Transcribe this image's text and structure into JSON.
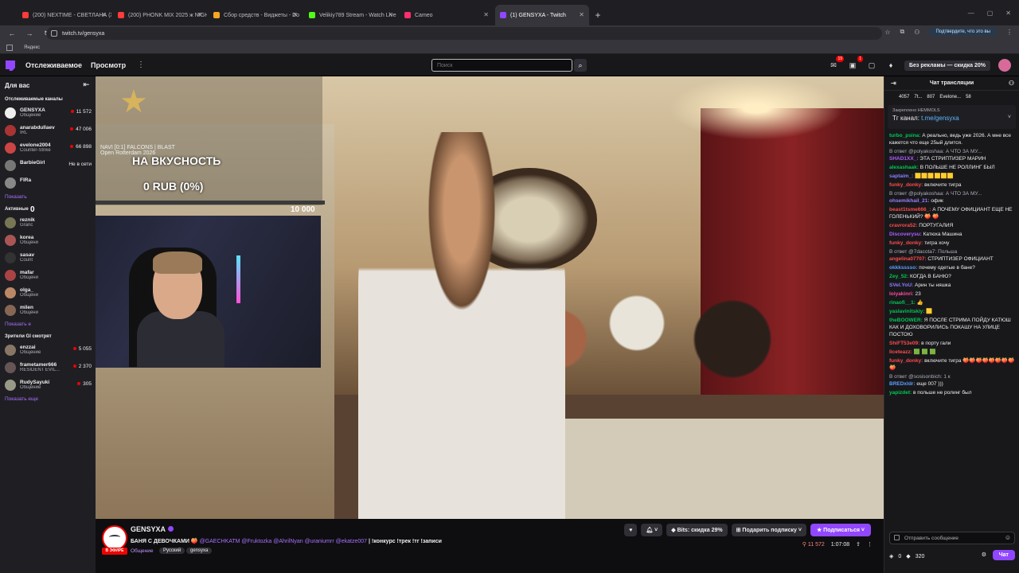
{
  "browser": {
    "tabs": [
      {
        "label": "(200) NEXTIME - СВЕТЛАНА (Ж",
        "color": "#ff3b3b"
      },
      {
        "label": "(200) PHONK MIX 2025 ж NIGH",
        "color": "#ff3b3b"
      },
      {
        "label": "Сбор средств - Виджеты - Do",
        "color": "#f6a623"
      },
      {
        "label": "Velikiy789 Stream - Watch Live",
        "color": "#53fc18"
      },
      {
        "label": "Cameo",
        "color": "#ff2e6e"
      },
      {
        "label": "(1) GENSYXA - Twitch",
        "color": "#9147ff"
      }
    ],
    "url": "twitch.tv/gensyxa",
    "confirm_label": "Подтвердите, что это вы",
    "bookmark": "Яндекс"
  },
  "topnav": {
    "following": "Отслеживаемое",
    "browse": "Просмотр",
    "search_placeholder": "Поиск",
    "notif_count": "19",
    "inbox_count": "1",
    "noads_label": "Без рекламы — скидка 20%"
  },
  "sidebar": {
    "for_you": "Для вас",
    "followed_title": "Отслеживаемые каналы",
    "followed": [
      {
        "name": "GENSYXA",
        "game": "Общение",
        "viewers": "11 572",
        "color": "#eeeeee"
      },
      {
        "name": "anarabdullaev",
        "game": "IRL",
        "viewers": "47 006",
        "color": "#a33"
      },
      {
        "name": "evelone2004",
        "game": "Counter-Strike",
        "viewers": "66 898",
        "color": "#c44"
      },
      {
        "name": "BarbieGirl",
        "game": "",
        "viewers": "Не в сети",
        "color": "#777"
      },
      {
        "name": "FlRa",
        "game": "",
        "viewers": "",
        "color": "#888"
      }
    ],
    "show_more_1": "Показать",
    "active_title": "Активные",
    "active": [
      {
        "name": "reznik",
        "game": "Granc",
        "color": "#775"
      },
      {
        "name": "korea",
        "game": "Общени",
        "color": "#a55"
      },
      {
        "name": "sasav",
        "game": "Count",
        "color": "#333"
      },
      {
        "name": "mafar",
        "game": "Общени",
        "color": "#a44"
      },
      {
        "name": "olga_",
        "game": "Общени",
        "color": "#b86"
      },
      {
        "name": "milen",
        "game": "Общени",
        "color": "#865"
      }
    ],
    "show_more_2": "Показать е",
    "viewers_title": "Зрители Gl смотрят",
    "watched": [
      {
        "name": "enzzai",
        "game": "Общение",
        "viewers": "5 055",
        "color": "#876"
      },
      {
        "name": "frametamer666",
        "game": "RESIDENT EVIL...",
        "viewers": "2 370",
        "color": "#655"
      },
      {
        "name": "RudySayuki",
        "game": "Общение",
        "viewers": "305",
        "color": "#998"
      }
    ],
    "show_more_3": "Показать еще"
  },
  "video": {
    "match_line1": "NAVI [0:1] FALCONS | BLAST",
    "match_line2": "Open Rotterdam 2026",
    "goal_title": "НА ВКУСНОСТЬ",
    "goal_amount": "0 RUB (0%)",
    "goal_min": "0",
    "goal_max": "10 000",
    "goal_progress": 0
  },
  "info": {
    "channel": "GENSYXA",
    "live_label": "В ЭФИРЕ",
    "title_start": "БАНЯ С ДЕВОЧКАМИ 🍑",
    "mentions": "@GAECHKATM @Fruktozka @AhrilNyan @uraniumrr @ekatze007",
    "title_end": "| !конкурс !трек !тг !записи",
    "category": "Общение",
    "tag1": "Русский",
    "tag2": "gensyxa",
    "bits_label": "Bits: скидка 29%",
    "gift_label": "Подарить подписку",
    "subscribe_label": "Подписаться",
    "viewers": "11 572",
    "uptime": "1:07:08"
  },
  "chat": {
    "title": "Чат трансляции",
    "giftbar": [
      "4057",
      "7t...",
      "807",
      "Evelone...",
      "58"
    ],
    "pinned_by": "Закреплено HEMMOLS",
    "pinned_text_a": "Тг канал: ",
    "pinned_text_b": "t.me/gensyxa",
    "messages": [
      {
        "user": "turbo_psina:",
        "color": "#00c853",
        "text": "А реально, ведь уже 2026. А мне все кажется что еще 25ый длится.",
        "reply": ""
      },
      {
        "user": "SHAD1XX_:",
        "color": "#b05cff",
        "text": "ЭТА СТРИПТИЗЕР МАРИН",
        "reply": "В ответ @polyakoshaa: А ЧТО ЗА МУ..."
      },
      {
        "user": "alexashaak:",
        "color": "#00c853",
        "text": "В ПОЛЬШЕ НЕ РОЛЛИНГ БЫЛ",
        "reply": ""
      },
      {
        "user": "saptaim_:",
        "color": "#8a7dff",
        "text": "🟨🟨🟨🟨🟨🟨",
        "reply": ""
      },
      {
        "user": "funky_donky:",
        "color": "#ff4b4b",
        "text": "включите тигра",
        "reply": ""
      },
      {
        "user": "ohsemikhail_21:",
        "color": "#9e7dff",
        "text": "офик",
        "reply": "В ответ @polyakoshaa: А ЧТО ЗА МУ..."
      },
      {
        "user": "beast1tsme666_:",
        "color": "#ff4b4b",
        "text": "А ПОЧЕМУ ОФИЦИАНТ ЕЩЕ НЕ ГОЛЕНЬКИЙ? 🍑 🍑",
        "reply": ""
      },
      {
        "user": "cravrora52:",
        "color": "#ff4b4b",
        "text": "ПОРТУГАЛИЯ",
        "reply": ""
      },
      {
        "user": "Discoverysu:",
        "color": "#b05cff",
        "text": "Катюха Машина",
        "reply": ""
      },
      {
        "user": "funky_donky:",
        "color": "#ff4b4b",
        "text": "тигра хочу",
        "reply": ""
      },
      {
        "user": "angelina07707:",
        "color": "#ff4b4b",
        "text": "СТРИПТИЗЕР ОФИЦИАНТ",
        "reply": "В ответ @7dacota7: Польша"
      },
      {
        "user": "okkksssso:",
        "color": "#5c9eff",
        "text": "почему одетые в бане?",
        "reply": ""
      },
      {
        "user": "Zey_52:",
        "color": "#00c853",
        "text": "КОГДА В БАНЮ?",
        "reply": ""
      },
      {
        "user": "SVel.YoU:",
        "color": "#8a7dff",
        "text": "Арин ты няшка",
        "reply": ""
      },
      {
        "user": "loiyakinri:",
        "color": "#ff4b9e",
        "text": "23",
        "reply": ""
      },
      {
        "user": "rinaofi__1:",
        "color": "#00c853",
        "text": "👍",
        "reply": ""
      },
      {
        "user": "yaslavinitskiy:",
        "color": "#00c853",
        "text": "🟨",
        "reply": ""
      },
      {
        "user": "theBOOWER:",
        "color": "#00c853",
        "text": "Я ПОСЛЕ СТРИМА ПОЙДУ КАТЮШ КАК И ДОХОВОРИЛИСЬ ПОКАШУ НА УЛИЦЕ ПОСТОЮ",
        "reply": ""
      },
      {
        "user": "ShiFT53e09:",
        "color": "#ff4b4b",
        "text": "в порту гали",
        "reply": ""
      },
      {
        "user": "liceteazz:",
        "color": "#ff4b4b",
        "text": "🟩 🟩 🟩",
        "reply": ""
      },
      {
        "user": "funky_donky:",
        "color": "#ff4b4b",
        "text": "включите тигра 🍑🍑🍑🍑🍑🍑🍑🍑🍑",
        "reply": ""
      },
      {
        "user": "BREDxldr:",
        "color": "#5c9eff",
        "text": "еще 007 )))",
        "reply": "В ответ @sosisonbich: 1 к"
      },
      {
        "user": "yapizdet:",
        "color": "#00c853",
        "text": "в польше не ролинг был",
        "reply": ""
      }
    ],
    "input_placeholder": "Отправить сообщение",
    "points": "0",
    "bits": "320",
    "chat_button": "Чат"
  },
  "colors": {
    "accent": "#9147ff",
    "live": "#eb0400",
    "bg": "#0e0e10"
  }
}
